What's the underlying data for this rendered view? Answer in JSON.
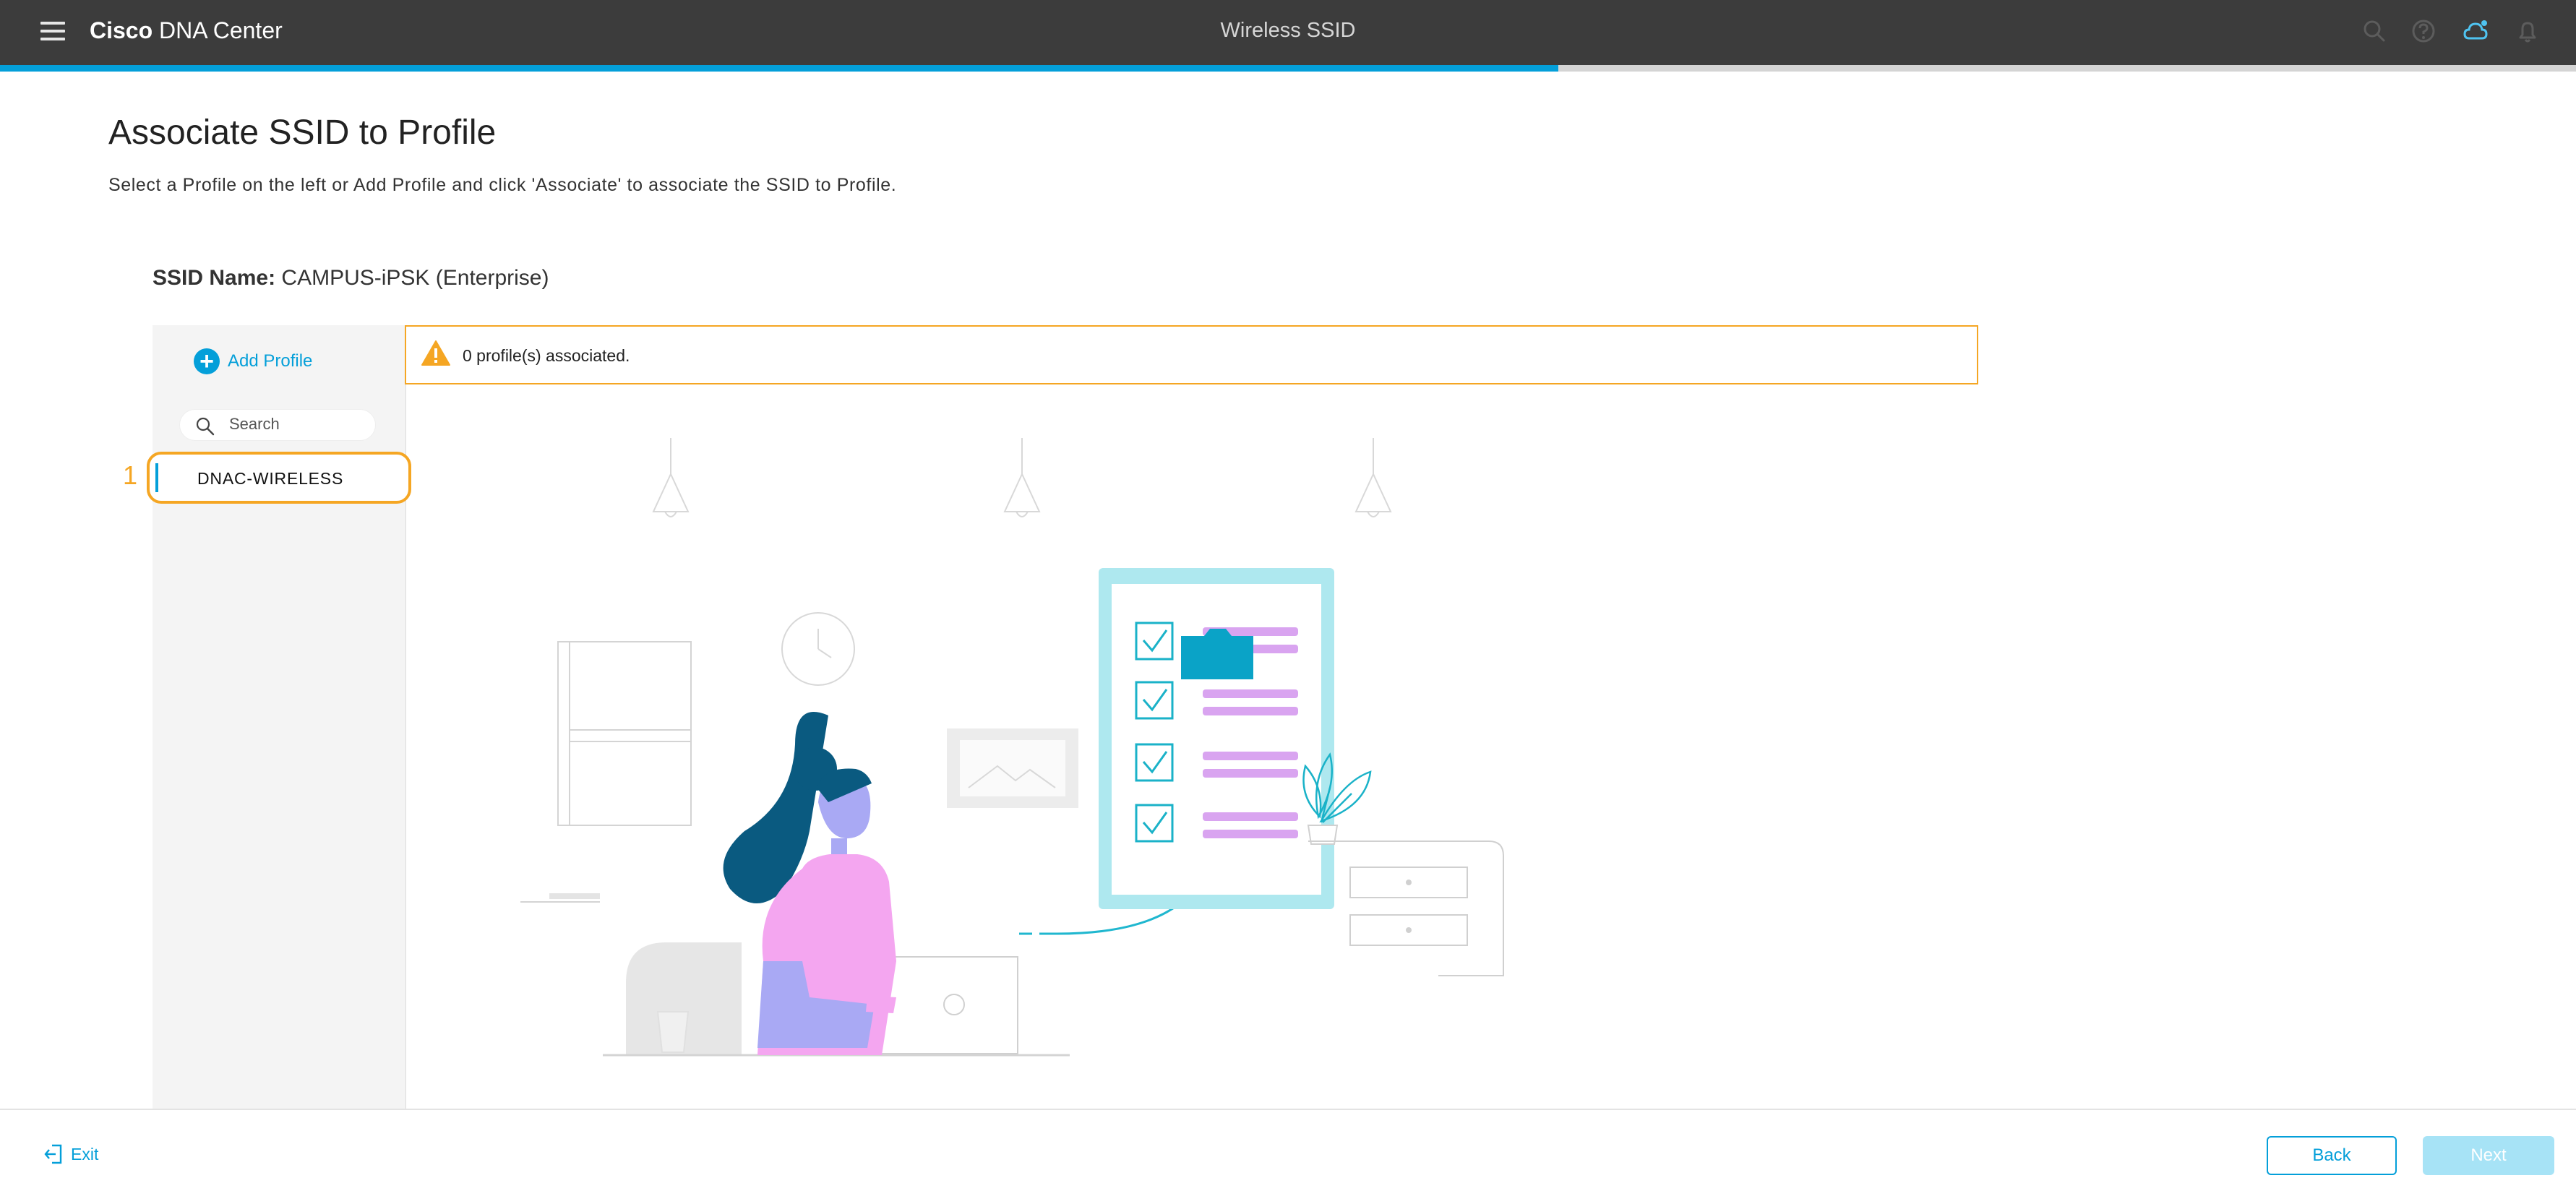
{
  "header": {
    "brand_bold": "Cisco",
    "brand_rest": " DNA Center",
    "page_title": "Wireless SSID",
    "icons": [
      "menu-icon",
      "search-icon",
      "help-icon",
      "cloud-icon",
      "bell-icon"
    ],
    "wizard_progress": 0.605
  },
  "main": {
    "title": "Associate SSID to Profile",
    "subtitle": "Select a Profile on the left or Add Profile and click 'Associate' to associate the SSID to Profile.",
    "ssid_label": "SSID Name:",
    "ssid_value": " CAMPUS-iPSK (Enterprise)"
  },
  "sidebar": {
    "add_profile_label": "Add Profile",
    "search_placeholder": "Search",
    "step_number": "1",
    "profiles": [
      {
        "name": "DNAC-WIRELESS",
        "selected": true
      }
    ]
  },
  "alert": {
    "message": "0 profile(s) associated.",
    "color": "#f5a623"
  },
  "footer": {
    "exit_label": "Exit",
    "back_label": "Back",
    "next_label": "Next"
  },
  "colors": {
    "accent": "#049fd9",
    "header_bg": "#3c3c3c",
    "highlight": "#f5a623"
  }
}
